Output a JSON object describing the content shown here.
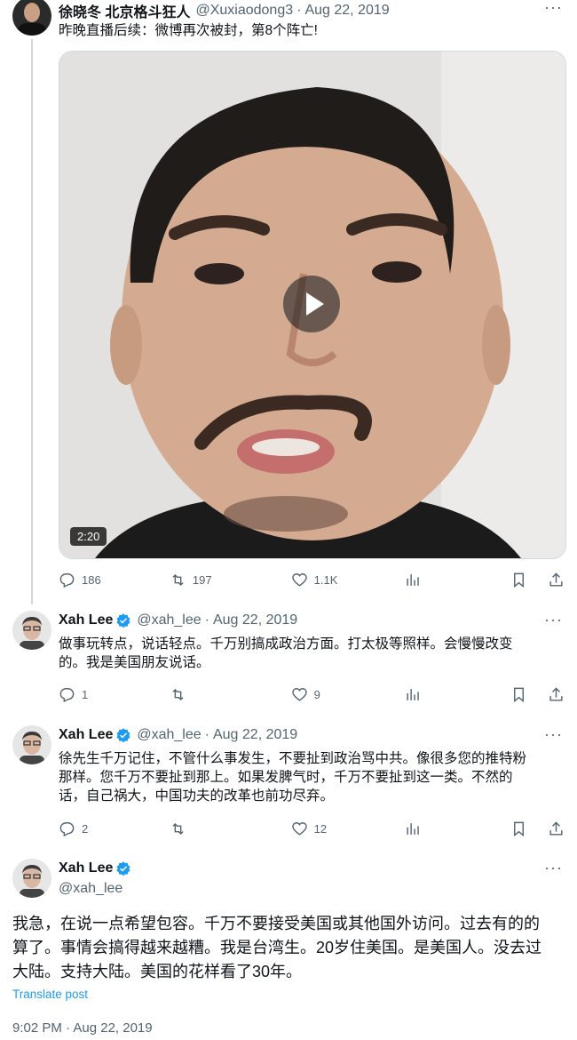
{
  "tweets": [
    {
      "name": "徐晓冬 北京格斗狂人",
      "handle": "@Xuxiaodong3",
      "date": "Aug 22, 2019",
      "text": "昨晚直播后续：微博再次被封，第8个阵亡!",
      "media": {
        "duration": "2:20"
      },
      "stats": {
        "replies": "186",
        "retweets": "197",
        "likes": "1.1K"
      }
    },
    {
      "name": "Xah Lee",
      "handle": "@xah_lee",
      "date": "Aug 22, 2019",
      "text": [
        "做事玩转点，说话轻点。千万别搞成政治方面。打太极等照样。会慢慢改变",
        "的。我是美国朋友说话。"
      ],
      "stats": {
        "replies": "1",
        "retweets": "",
        "likes": "9"
      }
    },
    {
      "name": "Xah Lee",
      "handle": "@xah_lee",
      "date": "Aug 22, 2019",
      "text": [
        "徐先生千万记住，不管什么事发生，不要扯到政治骂中共。像很多您的推特粉",
        "那样。您千万不要扯到那上。如果发脾气时，千万不要扯到这一类。不然的",
        "话，自己祸大，中国功夫的改革也前功尽弃。"
      ],
      "stats": {
        "replies": "2",
        "retweets": "",
        "likes": "12"
      }
    }
  ],
  "main_tweet": {
    "name": "Xah Lee",
    "handle": "@xah_lee",
    "text": [
      "我急，在说一点希望包容。千万不要接受美国或其他国外访问。过去有的的",
      "算了。事情会搞得越来越糟。我是台湾生。20岁住美国。是美国人。没去过",
      "大陆。支持大陆。美国的花样看了30年。"
    ],
    "translate_label": "Translate post",
    "timestamp": "9:02 PM · Aug 22, 2019"
  },
  "colors": {
    "accent": "#1d9bf0",
    "muted": "#536471",
    "line": "#cfd9de"
  },
  "icons": [
    "reply-icon",
    "retweet-icon",
    "like-icon",
    "views-icon",
    "bookmark-icon",
    "share-icon",
    "verified-badge-icon",
    "more-icon",
    "play-icon"
  ]
}
